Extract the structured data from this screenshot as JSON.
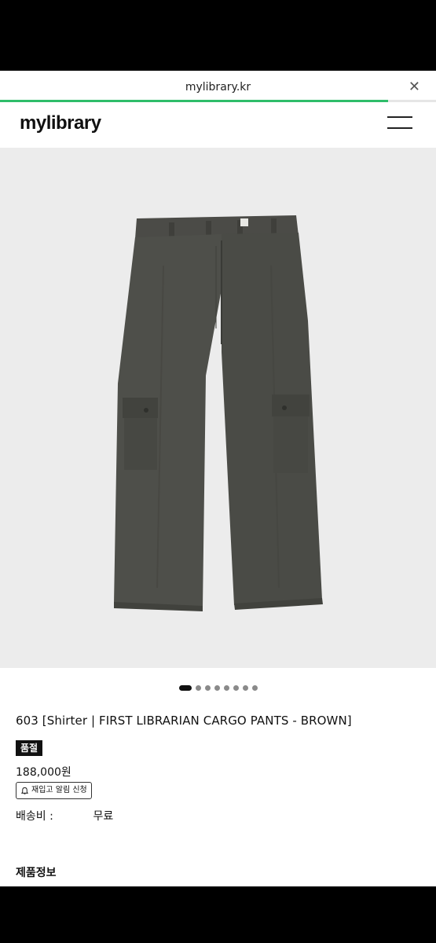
{
  "browser": {
    "url": "mylibrary.kr",
    "close_icon": "close-icon",
    "load_progress": 0.89,
    "progress_color": "#2fbd6a"
  },
  "header": {
    "logo": "mylibrary",
    "menu_icon": "hamburger-menu-icon"
  },
  "gallery": {
    "image_alt": "product-image-cargo-pants",
    "page_count": 8,
    "active_index": 0
  },
  "product": {
    "title": "603 [Shirter | FIRST LIBRARIAN CARGO PANTS - BROWN]",
    "badge": "품절",
    "price": "188,000원",
    "restock_label": "재입고 알림 신청",
    "shipping_label": "배송비 :",
    "shipping_value": "무료"
  },
  "details": {
    "section_title": "제품정보"
  }
}
